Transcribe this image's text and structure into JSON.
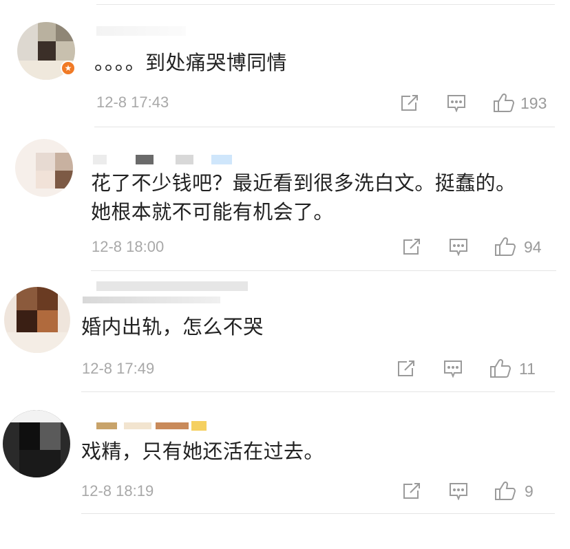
{
  "comments": [
    {
      "text_lines": [
        "。。。。到处痛哭博同情"
      ],
      "time": "12-8 17:43",
      "likes": "193"
    },
    {
      "text_lines": [
        "花了不少钱吧？最近看到很多洗白文。挺蠢的。",
        "她根本就不可能有机会了。"
      ],
      "time": "12-8 18:00",
      "likes": "94"
    },
    {
      "text_lines": [
        "婚内出轨，怎么不哭"
      ],
      "time": "12-8 17:49",
      "likes": "11"
    },
    {
      "text_lines": [
        "戏精，只有她还活在过去。"
      ],
      "time": "12-8 18:19",
      "likes": "9"
    }
  ],
  "icons": {
    "share": "share-icon",
    "comment": "comment-icon",
    "like": "thumbs-up-icon",
    "verified": "verified-badge-icon"
  },
  "colors": {
    "time_text": "#a8a8a8",
    "icon_gray": "#9a9a9a",
    "verified_badge": "#f07a26"
  }
}
